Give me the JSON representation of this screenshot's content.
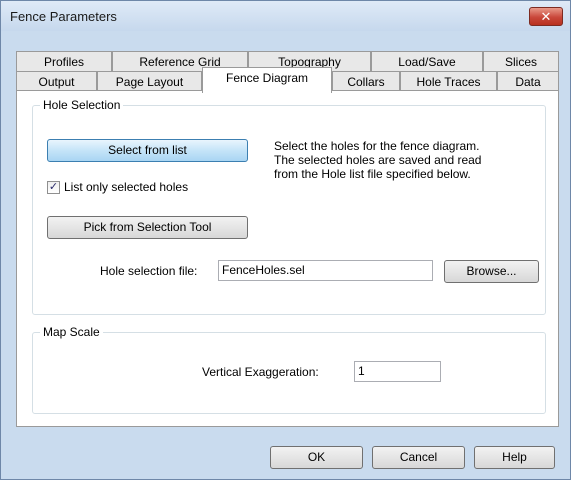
{
  "window": {
    "title": "Fence Parameters",
    "close_glyph": "✕"
  },
  "tabs": {
    "row_back": [
      "Profiles",
      "Reference Grid",
      "Topography",
      "Load/Save",
      "Slices"
    ],
    "row_front": [
      "Output",
      "Page Layout",
      "Fence Diagram",
      "Collars",
      "Hole Traces",
      "Data"
    ],
    "active": "Fence Diagram"
  },
  "hole_selection": {
    "group_label": "Hole Selection",
    "select_button": "Select from list",
    "list_only_checkbox": {
      "label": "List only selected holes",
      "checked": true,
      "mark": "✓"
    },
    "pick_button": "Pick from Selection Tool",
    "info_text": [
      "Select the holes for the fence diagram.",
      "The selected holes are saved and read",
      "from the Hole list file specified below."
    ],
    "file_label": "Hole selection file:",
    "file_value": "FenceHoles.sel",
    "browse_button": "Browse..."
  },
  "map_scale": {
    "group_label": "Map Scale",
    "vertical_exaggeration_label": "Vertical Exaggeration:",
    "vertical_exaggeration_value": "1"
  },
  "footer": {
    "ok": "OK",
    "cancel": "Cancel",
    "help": "Help"
  }
}
